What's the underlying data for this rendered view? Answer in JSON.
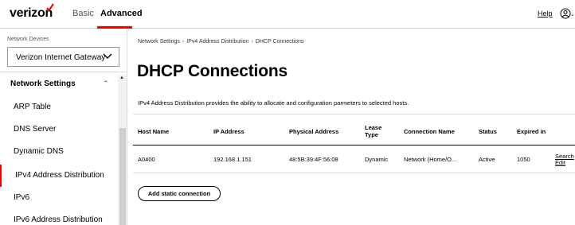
{
  "header": {
    "logo": "verizon",
    "tabs": [
      {
        "label": "Basic"
      },
      {
        "label": "Advanced"
      }
    ],
    "help": "Help",
    "accent": "#ee0000"
  },
  "sidebar": {
    "devices_label": "Network Devices",
    "device_selected": "Verizon Internet Gateway",
    "section_title": "Network Settings",
    "items": [
      {
        "label": "ARP Table"
      },
      {
        "label": "DNS Server"
      },
      {
        "label": "Dynamic DNS"
      },
      {
        "label": "IPv4 Address Distribution"
      },
      {
        "label": "IPv6"
      },
      {
        "label": "IPv6 Address Distribution"
      }
    ]
  },
  "main": {
    "breadcrumb": [
      "Network Settings",
      "IPv4 Address Distribution",
      "DHCP Connections"
    ],
    "title": "DHCP Connections",
    "description": "IPv4 Address Distribution provides the ability to allocate and configuration parmeters to selected hosts.",
    "table": {
      "headers": [
        "Host Name",
        "IP Address",
        "Physical Address",
        "Lease Type",
        "Connection Name",
        "Status",
        "Expired in"
      ],
      "rows": [
        {
          "host": "A0400",
          "ip": "192.168.1.151",
          "mac": "48:5B:39:4F:56:08",
          "lease": "Dynamic",
          "connection": "Network (Home/O...",
          "status": "Active",
          "expires": "1050",
          "actions": [
            "Search",
            "Edit"
          ]
        }
      ]
    },
    "add_button": "Add static connection"
  }
}
